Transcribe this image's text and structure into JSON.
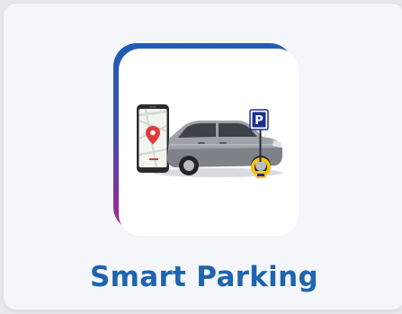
{
  "card": {
    "title": "Smart Parking",
    "parking_sign_letter": "P",
    "icon": "smart-parking-illustration",
    "colors": {
      "title": "#1f64ae",
      "gradient_top": "#1f5cb8",
      "gradient_bottom": "#a62a94",
      "card_background": "#f4f6f9",
      "sign_blue": "#1d2f8f"
    }
  }
}
